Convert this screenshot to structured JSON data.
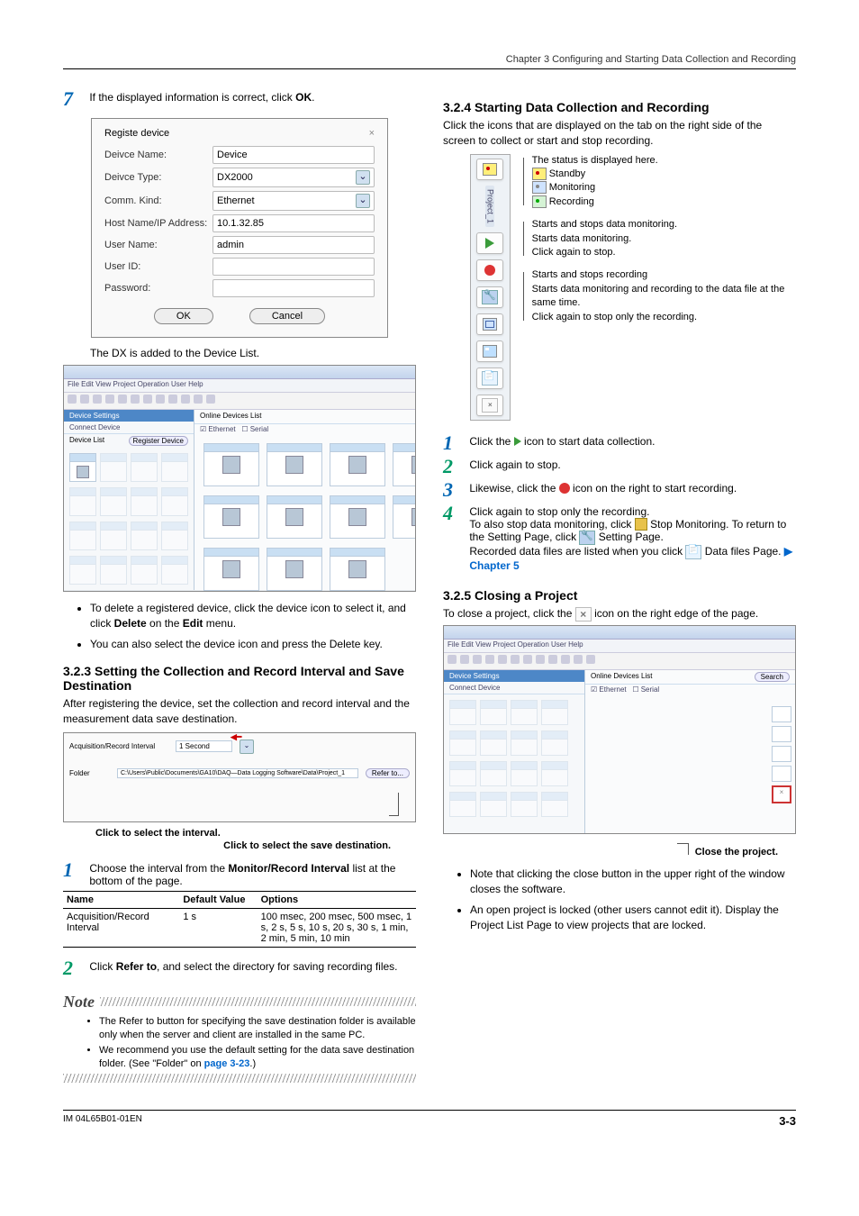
{
  "header": "Chapter 3   Configuring and Starting Data Collection and Recording",
  "left": {
    "step7_num": "7",
    "step7_text_a": "If the displayed information is correct, click ",
    "step7_text_ok": "OK",
    "step7_text_b": ".",
    "dlg": {
      "title": "Registe device",
      "close": "×",
      "rows": {
        "name_lbl": "Deivce Name:",
        "name_val": "Device",
        "type_lbl": "Deivce Type:",
        "type_val": "DX2000",
        "comm_lbl": "Comm. Kind:",
        "comm_val": "Ethernet",
        "host_lbl": "Host Name/IP Address:",
        "host_val": "10.1.32.85",
        "user_lbl": "User Name:",
        "user_val": "admin",
        "uid_lbl": "User ID:",
        "pwd_lbl": "Password:"
      },
      "ok": "OK",
      "cancel": "Cancel"
    },
    "after_dlg": "The DX is added to the Device List.",
    "ss_tabs": "Device Settings",
    "ss_menu": "File  Edit  View  Project  Operation  User  Help",
    "ss_connect": "Connect Device",
    "ss_devlist": "Device List",
    "ss_online": "Online Devices List",
    "ss_regdev": "Register Device",
    "ss_search": "Search",
    "ss_eth": "Ethernet",
    "ss_serial": "Serial",
    "bullets": {
      "b1a": "To delete a registered device, click the device icon to select it, and click ",
      "b1b": "Delete",
      "b1c": " on the ",
      "b1d": "Edit",
      "b1e": " menu.",
      "b2": "You can also select the device icon and press the Delete key."
    },
    "sec323": "3.2.3  Setting the Collection and Record Interval and Save Destination",
    "sec323_p": "After registering the device, set the collection and record interval and the measurement data save destination.",
    "int_lbl_l": "Acquisition/Record Interval",
    "int_val": "1 Second",
    "fold_lbl": "Folder",
    "fold_val": "C:\\Users\\Public\\Documents\\GA10\\DAQ—Data Logging Software\\Data\\Project_1",
    "refer": "Refer to...",
    "callout1": "Click to select the interval.",
    "callout2": "Click to select the save destination.",
    "step1_num": "1",
    "step1_a": "Choose the interval from the ",
    "step1_b": "Monitor/Record Interval",
    "step1_c": " list at the bottom of the page.",
    "table": {
      "h1": "Name",
      "h2": "Default Value",
      "h3": "Options",
      "r1c1": "Acquisition/Record Interval",
      "r1c2": "1 s",
      "r1c3": "100 msec, 200 msec, 500 msec, 1 s, 2 s, 5 s, 10 s, 20 s, 30 s, 1 min, 2 min, 5 min, 10 min"
    },
    "step2_num": "2",
    "step2_a": "Click ",
    "step2_b": "Refer to",
    "step2_c": ", and select the directory for saving recording files.",
    "note": "Note",
    "note1": "The Refer to button for specifying the save destination folder is available only when the server and client are installed in the same PC.",
    "note2a": "We recommend you use the default setting for the data save destination folder. (See \"Folder\" on ",
    "note2b": "page 3-23",
    "note2c": ".)"
  },
  "right": {
    "sec324": "3.2.4  Starting Data Collection and Recording",
    "sec324_p": "Click the icons that are displayed on the tab on the right side of the screen to collect or start and stop recording.",
    "vt_project": "Project_1",
    "desc": {
      "status_head": "The status is displayed here.",
      "standby": "Standby",
      "monitoring": "Monitoring",
      "recording": "Recording",
      "play_head": "Starts and stops data monitoring.",
      "play_l1": "Starts data monitoring.",
      "play_l2": "Click again to stop.",
      "rec_head": "Starts and stops recording",
      "rec_l1": "Starts data monitoring and recording to the data file at the same time.",
      "rec_l2": "Click again to stop only the recording."
    },
    "s1_num": "1",
    "s1_a": "Click the ",
    "s1_b": " icon to start data collection.",
    "s2_num": "2",
    "s2": "Click again to stop.",
    "s3_num": "3",
    "s3_a": "Likewise, click the ",
    "s3_b": " icon on the right to start recording.",
    "s4_num": "4",
    "s4": "Click again to stop only the recording.",
    "s4_p2a": "To also stop data monitoring, click ",
    "s4_p2b": " Stop Monitoring. To return to the Setting Page, click ",
    "s4_p2c": " Setting Page.",
    "s4_p3a": "Recorded data files are listed when you click ",
    "s4_p3b": " Data files Page. ",
    "s4_chap": "Chapter 5",
    "sec325": "3.2.5  Closing a Project",
    "sec325_p_a": "To close a project, click the ",
    "sec325_p_b": " icon on the right edge of the page.",
    "close_cap": "Close the project.",
    "bul1": "Note that clicking the close button in the upper right of the window closes the software.",
    "bul2": "An open project is locked (other users cannot edit it). Display the Project List Page to view projects that are locked."
  },
  "footer": {
    "left": "IM 04L65B01-01EN",
    "right": "3-3"
  }
}
